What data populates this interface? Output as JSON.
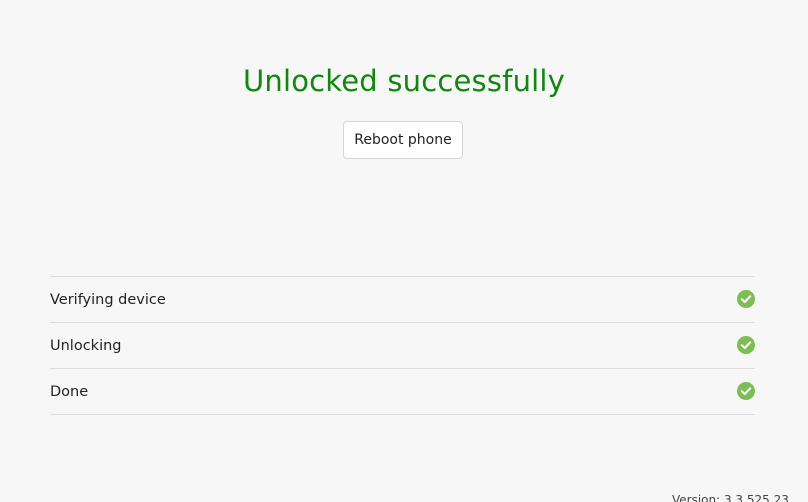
{
  "title": "Unlocked successfully",
  "reboot_button": "Reboot phone",
  "steps": [
    {
      "label": "Verifying device",
      "status_icon": "check-circle-icon"
    },
    {
      "label": "Unlocking",
      "status_icon": "check-circle-icon"
    },
    {
      "label": "Done",
      "status_icon": "check-circle-icon"
    }
  ],
  "version": "Version: 3.3.525.23",
  "colors": {
    "success_title": "#11870f",
    "check_icon": "#7dbd55",
    "background": "#f7f7f7"
  }
}
